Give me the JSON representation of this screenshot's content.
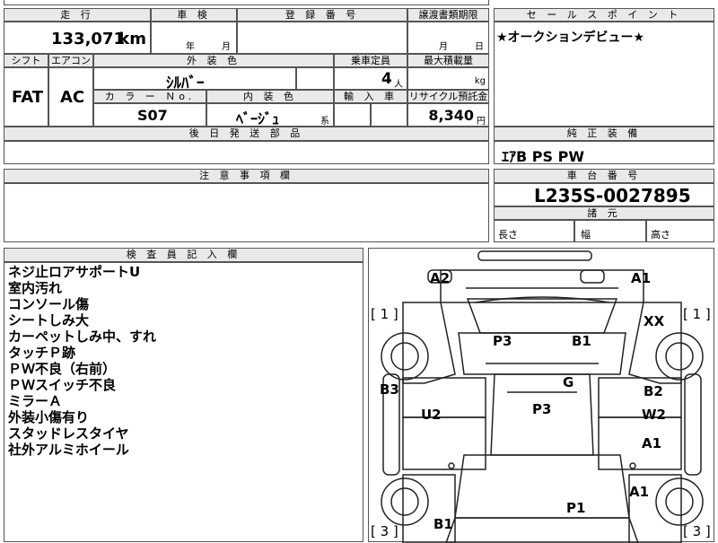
{
  "top": {
    "mileage_label": "走 行",
    "mileage_value": "133,071",
    "mileage_unit": "km",
    "inspection_label": "車 検",
    "inspection_year": "年",
    "inspection_month": "月",
    "registration_label": "登 録 番 号",
    "transfer_label": "譲渡書類期限",
    "transfer_month": "月",
    "transfer_day": "日"
  },
  "sales": {
    "label": "セ ー ル ス ポ イ ン ト",
    "text": "★オークションデビュー★"
  },
  "spec": {
    "shift_label": "シフト",
    "ac_label": "エアコン",
    "color_label": "外 装 色",
    "seats_label": "乗車定員",
    "load_label": "最大積載量",
    "shift_value": "FAT",
    "ac_value": "AC",
    "color_value": "ｼﾙﾊﾞｰ",
    "seats_value": "4",
    "seats_unit": "人",
    "load_unit": "kg",
    "colorno_label": "カ ラ ー Ｎo.",
    "interior_label": "内 装 色",
    "import_label": "輸 入 車",
    "recycle_label": "リサイクル預託金",
    "colorno_value": "S07",
    "interior_value": "ﾍﾞｰｼﾞｭ",
    "interior_suffix": "系",
    "recycle_value": "8,340",
    "recycle_unit": "円"
  },
  "later_parts": {
    "label": "後 日 発 送 部 品"
  },
  "equipment": {
    "label": "純 正 装 備",
    "text": "ｴｱB PS PW"
  },
  "caution": {
    "label": "注 意 事 項 欄"
  },
  "chassis": {
    "label": "車 台 番 号",
    "value": "L235S-0027895",
    "dims_label": "諸 元",
    "length_label": "長さ",
    "width_label": "幅",
    "height_label": "高さ"
  },
  "inspector": {
    "label": "検 査 員 記 入 欄",
    "notes": [
      "ネジ止ロアサポートU",
      "室内汚れ",
      "コンソール傷",
      "シートしみ大",
      "カーペットしみ中、すれ",
      "タッチＰ跡",
      "ＰＷ不良（右前）",
      "ＰＷスイッチ不良",
      "ミラーＡ",
      "外装小傷有り",
      "スタッドレスタイヤ",
      "社外アルミホイール"
    ]
  },
  "diagram": {
    "bracket_left_top": "[ 1 ]",
    "bracket_right_top": "[ 1 ]",
    "bracket_left_bottom": "[ 3 ]",
    "bracket_right_bottom": "[ 3 ]",
    "marks": {
      "a2": "A2",
      "a1_top": "A1",
      "xx": "XX",
      "p3_upper": "P3",
      "b1_upper": "B1",
      "b3": "B3",
      "g": "G",
      "b2": "B2",
      "u2": "U2",
      "p3_center": "P3",
      "w2": "W2",
      "a1_right": "A1",
      "a1_lower": "A1",
      "p1": "P1",
      "b1_lower": "B1"
    }
  }
}
